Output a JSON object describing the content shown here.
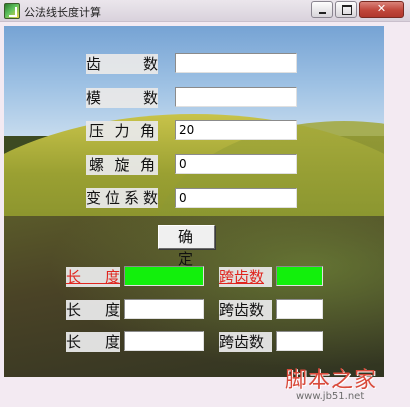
{
  "window": {
    "title": "公法线长度计算",
    "minimize_icon": "minimize-icon",
    "maximize_icon": "maximize-icon",
    "close_label": "✕"
  },
  "form": {
    "teeth_label": "齿　数",
    "module_label": "模　数",
    "pressure_angle_label": "压力角",
    "helix_angle_label": "螺旋角",
    "shift_coeff_label": "变位系数",
    "teeth_value": "",
    "module_value": "",
    "pressure_angle_value": "20",
    "helix_angle_value": "0",
    "shift_coeff_value": "0",
    "confirm_label": "确定"
  },
  "results": {
    "rows": [
      {
        "length_label": "长　度",
        "span_label": "跨齿数",
        "length_value": "",
        "span_value": "",
        "highlight": true
      },
      {
        "length_label": "长　度",
        "span_label": "跨齿数",
        "length_value": "",
        "span_value": "",
        "highlight": false
      },
      {
        "length_label": "长　度",
        "span_label": "跨齿数",
        "length_value": "",
        "span_value": "",
        "highlight": false
      }
    ]
  },
  "watermark": {
    "text": "脚本之家",
    "url": "www.jb51.net"
  },
  "colors": {
    "accent_red": "#e0251e",
    "result_green": "#12f00c"
  }
}
